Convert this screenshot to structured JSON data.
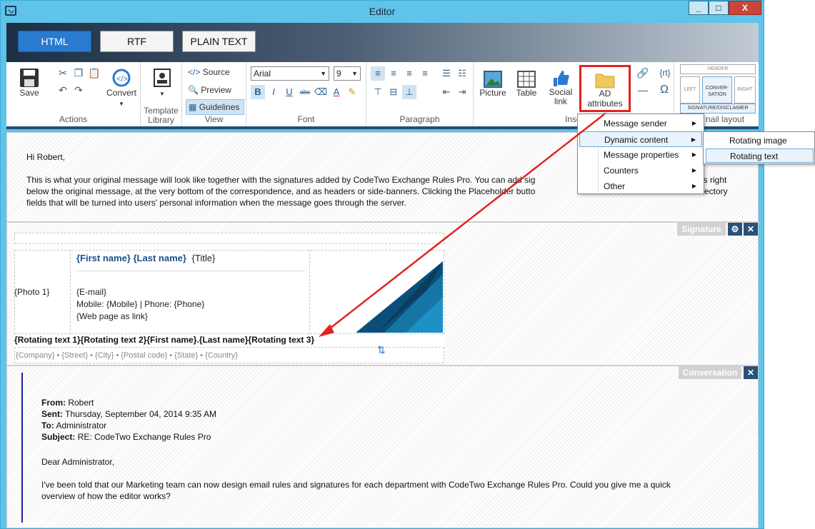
{
  "window": {
    "title": "Editor",
    "minimize": "_",
    "maximize": "□",
    "close": "X"
  },
  "formats": [
    "HTML",
    "RTF",
    "PLAIN TEXT"
  ],
  "actions": {
    "save": "Save",
    "convert": "Convert",
    "label": "Actions"
  },
  "template": {
    "label1": "Template",
    "label2": "Library"
  },
  "view": {
    "source": "Source",
    "preview": "Preview",
    "guidelines": "Guidelines",
    "label": "View"
  },
  "font": {
    "name": "Arial",
    "size": "9",
    "label": "Font"
  },
  "paragraph": {
    "label": "Paragraph"
  },
  "insert": {
    "picture": "Picture",
    "table": "Table",
    "social1": "Social",
    "social2": "link",
    "ad": "AD attributes",
    "label": "Inse",
    "rt": "{rt}",
    "omega": "Ω"
  },
  "layout": {
    "header": "HEADER",
    "left": "LEFT",
    "conv1": "CONVER-",
    "conv2": "SATION",
    "right": "RIGHT",
    "sig": "SIGNATURE/DISCLAIMER",
    "label": "nail layout"
  },
  "menu": [
    "Message sender",
    "Dynamic content",
    "Message properties",
    "Counters",
    "Other"
  ],
  "submenu": [
    "Rotating image",
    "Rotating text"
  ],
  "intro": {
    "greeting": "Hi Robert,",
    "line1": "This is what your original message will look like together with the signatures added by CodeTwo Exchange Rules Pro. You can add sig",
    "line1b": "ers right",
    "line2": "below the original message, at the very bottom of the correspondence, and as headers or side-banners. Clicking the Placeholder butto",
    "line2b": "ectory",
    "line3": "fields that will be turned into users' personal information when the message goes through the server."
  },
  "signature": {
    "band": "Signature",
    "photo": "{Photo 1}",
    "first": "{First name}",
    "last": "{Last name}",
    "title": "{Title}",
    "email": "{E-mail}",
    "mobile": "Mobile:  {Mobile} | Phone: {Phone}",
    "web": "{Web page as link}",
    "rotating": "{Rotating text 1}{Rotating text 2}{First name}.{Last name}{Rotating text 3}",
    "address": "{Company} • {Street} • {City}  • {Postal code} • {State} • {Country}"
  },
  "conversation": {
    "band": "Conversation",
    "from_l": "From:",
    "from_v": " Robert",
    "sent_l": "Sent:",
    "sent_v": " Thursday, September 04, 2014 9:35 AM",
    "to_l": "To:",
    "to_v": " Administrator",
    "subj_l": "Subject:",
    "subj_v": " RE: CodeTwo Exchange Rules Pro",
    "dear": "Dear Administrator,",
    "body1": "I've been told that our Marketing team can now design email rules and signatures for each department with CodeTwo Exchange Rules Pro. Could you give me a quick",
    "body2": "overview of how the editor works?"
  },
  "colors": {
    "accent": "#2a7ad0",
    "highlight": "#e0241f",
    "link": "#1c4f8c"
  }
}
